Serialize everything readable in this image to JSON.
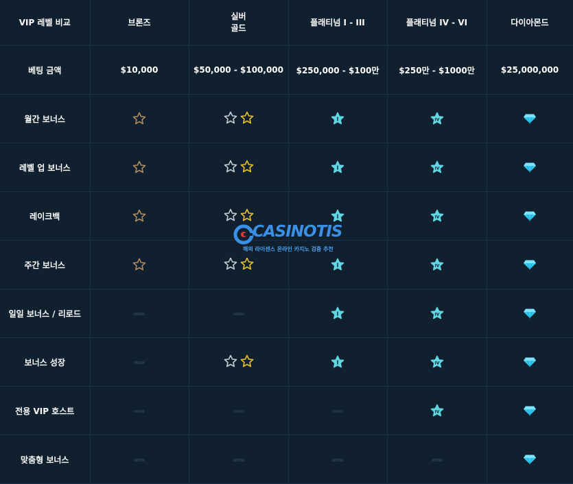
{
  "header": {
    "corner": "VIP 레벨 비교",
    "tiers": [
      {
        "lines": [
          "브론즈"
        ]
      },
      {
        "lines": [
          "실버",
          "골드"
        ]
      },
      {
        "lines": [
          "플래티넘 I - III"
        ]
      },
      {
        "lines": [
          "플래티넘 IV - VI"
        ]
      },
      {
        "lines": [
          "다이아몬드"
        ]
      }
    ]
  },
  "rows": [
    {
      "label": "베팅 금액",
      "cells": [
        "$10,000",
        "$50,000 - $100,000",
        "$250,000 - $100만",
        "$250만 - $1000만",
        "$25,000,000"
      ]
    },
    {
      "label": "월간 보너스",
      "cells": [
        "star-bronze",
        "star-silver-gold",
        "star-plat1",
        "star-plat4",
        "diamond"
      ]
    },
    {
      "label": "레벨 업 보너스",
      "cells": [
        "star-bronze",
        "star-silver-gold",
        "star-plat1",
        "star-plat4",
        "diamond"
      ]
    },
    {
      "label": "레이크백",
      "cells": [
        "star-bronze",
        "star-silver-gold",
        "star-plat1",
        "star-plat4",
        "diamond"
      ]
    },
    {
      "label": "주간 보너스",
      "cells": [
        "star-bronze",
        "star-silver-gold",
        "star-plat1",
        "star-plat4",
        "diamond"
      ]
    },
    {
      "label": "일일 보너스 / 리로드",
      "cells": [
        "dash",
        "dash",
        "star-plat1",
        "star-plat4",
        "diamond"
      ]
    },
    {
      "label": "보너스 성장",
      "cells": [
        "dash",
        "star-silver-gold",
        "star-plat1",
        "star-plat4",
        "diamond"
      ]
    },
    {
      "label": "전용 VIP 호스트",
      "cells": [
        "dash",
        "dash",
        "dash",
        "star-plat4",
        "diamond"
      ]
    },
    {
      "label": "맞춤형 보너스",
      "cells": [
        "dash",
        "dash",
        "dash",
        "dash",
        "diamond"
      ]
    }
  ],
  "watermark": {
    "brand": "CASINOTIS",
    "tagline": "해외 라이센스 온라인 카지노 검증 추천"
  },
  "colors": {
    "background": "#10202f",
    "grid": "#1b3042",
    "bronze": "#b08a5e",
    "silver": "#c7ccd2",
    "gold": "#e8c22a",
    "platinum": "#5fd6e2",
    "diamond": "#34c9f0"
  }
}
